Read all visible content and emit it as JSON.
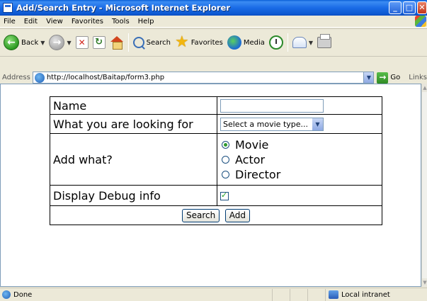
{
  "window": {
    "title": "Add/Search Entry - Microsoft Internet Explorer"
  },
  "menu": {
    "items": [
      "File",
      "Edit",
      "View",
      "Favorites",
      "Tools",
      "Help"
    ]
  },
  "toolbar": {
    "back_label": "Back",
    "search_label": "Search",
    "favorites_label": "Favorites",
    "media_label": "Media"
  },
  "address": {
    "label": "Address",
    "url": "http://localhost/Baitap/form3.php",
    "go_label": "Go",
    "links_label": "Links"
  },
  "form": {
    "name_label": "Name",
    "name_value": "",
    "looking_label": "What you are looking for",
    "select_value": "Select a movie type...",
    "add_label": "Add what?",
    "options": [
      "Movie",
      "Actor",
      "Director"
    ],
    "selected_option": "Movie",
    "debug_label": "Display Debug info",
    "debug_checked": true,
    "search_button": "Search",
    "add_button": "Add"
  },
  "status": {
    "text": "Done",
    "zone": "Local intranet"
  }
}
